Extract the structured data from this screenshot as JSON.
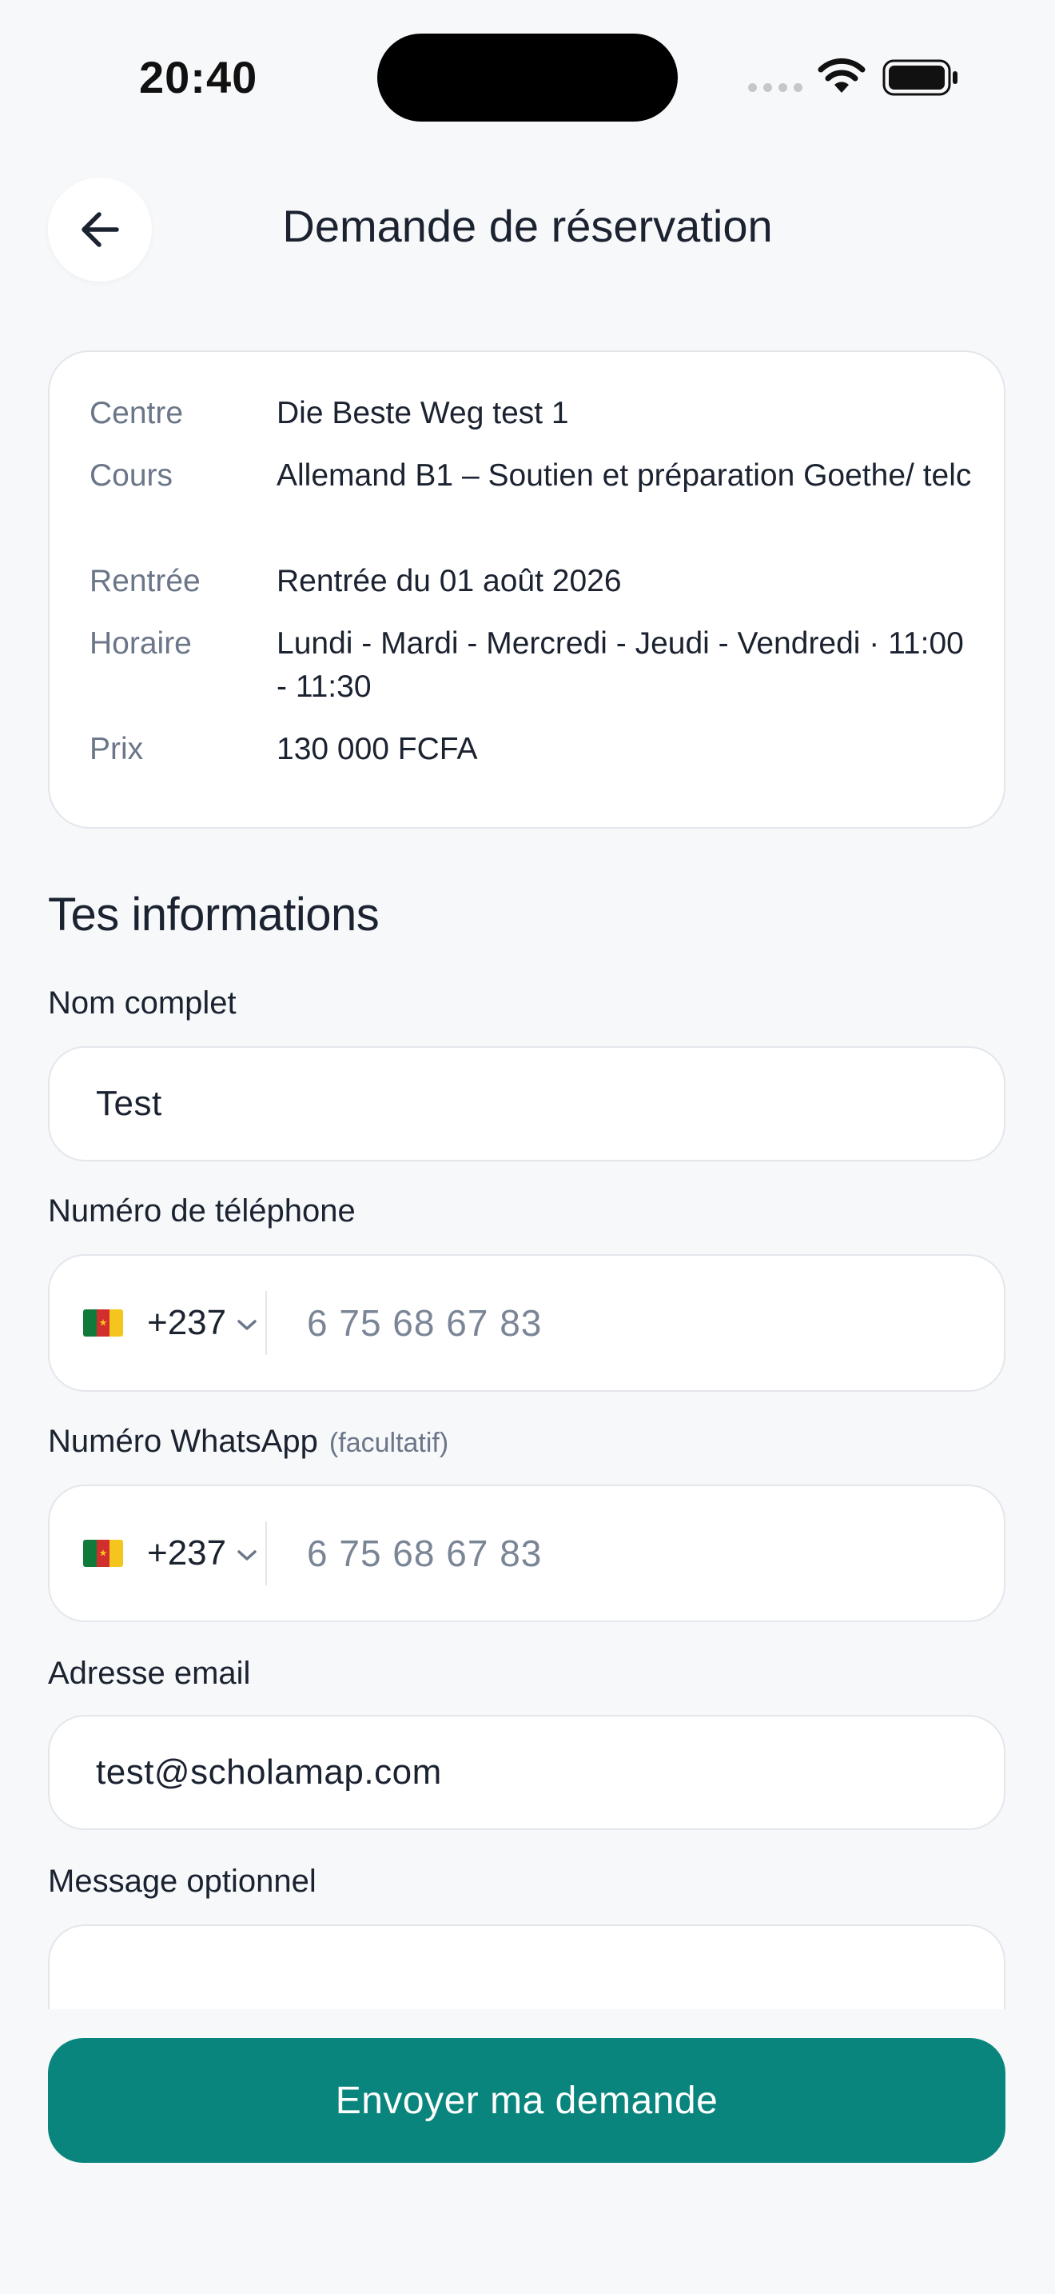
{
  "status_bar": {
    "time": "20:40"
  },
  "header": {
    "title": "Demande de réservation"
  },
  "summary": {
    "rows": [
      {
        "label": "Centre",
        "value": "Die Beste Weg test 1"
      },
      {
        "label": "Cours",
        "value": "Allemand B1 – Soutien et préparation Goethe/ telc"
      },
      {
        "label": "Rentrée",
        "value": "Rentrée du 01 août 2026"
      },
      {
        "label": "Horaire",
        "value": "Lundi - Mardi - Mercredi - Jeudi - Vendredi · 11:00 - 11:30"
      },
      {
        "label": "Prix",
        "value": "130 000 FCFA"
      }
    ]
  },
  "form": {
    "section_title": "Tes informations",
    "full_name": {
      "label": "Nom complet",
      "value": "Test"
    },
    "phone": {
      "label": "Numéro de téléphone",
      "country_code": "+237",
      "placeholder": "6 75 68 67 83"
    },
    "whatsapp": {
      "label": "Numéro WhatsApp",
      "optional_note": "(facultatif)",
      "country_code": "+237",
      "placeholder": "6 75 68 67 83"
    },
    "email": {
      "label": "Adresse email",
      "value": "test@scholamap.com"
    },
    "message": {
      "label": "Message optionnel",
      "value": ""
    },
    "submit_label": "Envoyer ma demande"
  },
  "icons": {
    "back": "arrow-left-icon",
    "flag": "cameroon-flag-icon",
    "dropdown": "chevron-down-icon",
    "wifi": "wifi-icon",
    "battery": "battery-icon"
  },
  "colors": {
    "primary": "#0a857d",
    "background": "#f7f8fa",
    "border": "#e3e6eb",
    "muted_text": "#6b7689"
  }
}
